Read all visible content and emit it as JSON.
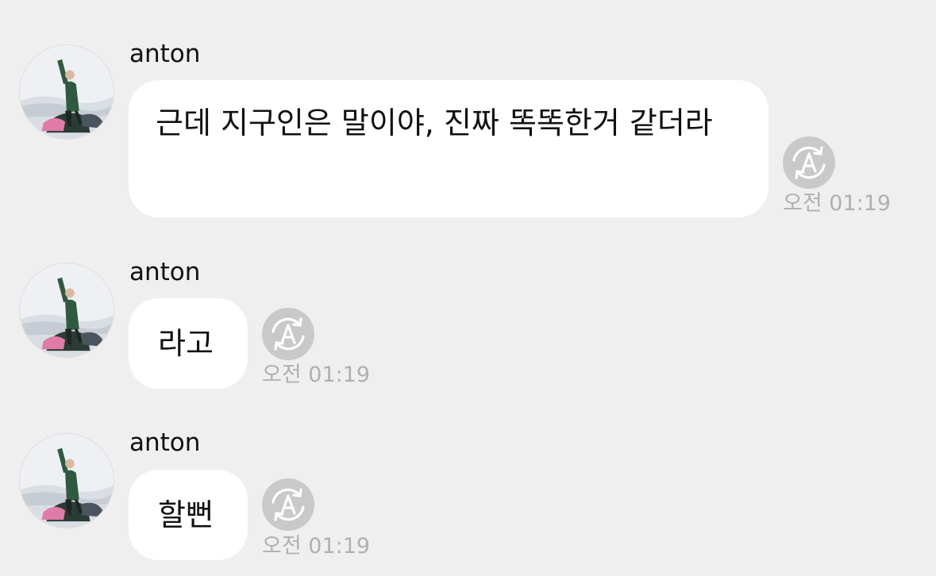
{
  "messages": [
    {
      "sender": "anton",
      "text": "근데 지구인은 말이야, 진짜 똑똑한거 같더라",
      "time": "오전 01:19",
      "icon": "translate-icon"
    },
    {
      "sender": "anton",
      "text": "라고",
      "time": "오전 01:19",
      "icon": "translate-icon"
    },
    {
      "sender": "anton",
      "text": "할뻔",
      "time": "오전 01:19",
      "icon": "translate-icon"
    }
  ],
  "colors": {
    "background": "#efefef",
    "bubble": "#ffffff",
    "time_text": "#b0b0b0",
    "translate_button": "#c9c9c9"
  }
}
